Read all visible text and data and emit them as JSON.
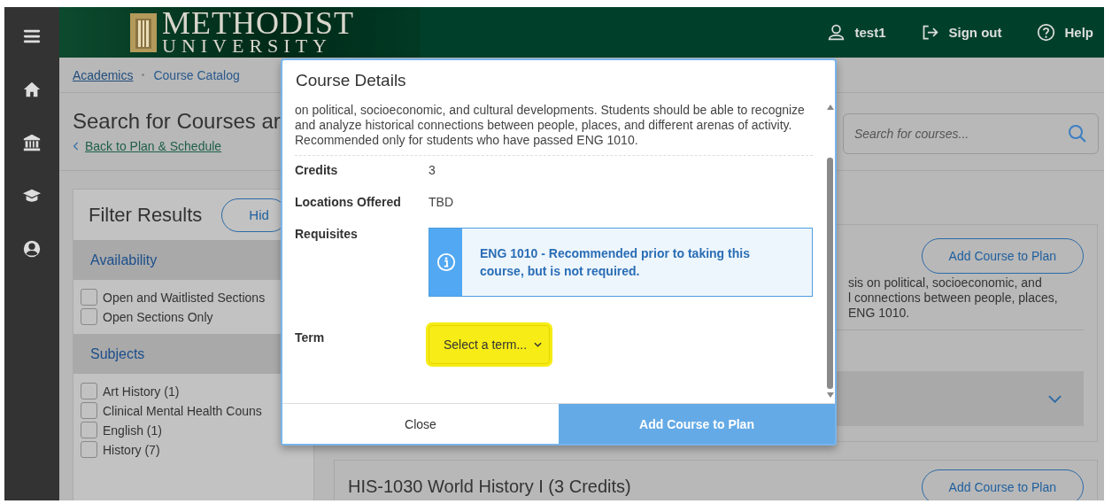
{
  "header": {
    "logo_line_1": "METHODIST",
    "logo_line_2": "UNIVERSITY",
    "user": "test1",
    "sign_out": "Sign out",
    "help": "Help"
  },
  "breadcrumbs": [
    {
      "label": "Academics",
      "link": true
    },
    {
      "label": "Course Catalog",
      "link": false
    }
  ],
  "page_title": "Search for Courses ar",
  "back_link": "Back to Plan & Schedule",
  "search": {
    "placeholder": "Search for courses..."
  },
  "filter": {
    "title": "Filter Results",
    "hide_button": "Hid",
    "sections": [
      {
        "title": "Availability",
        "options": [
          {
            "label": "Open and Waitlisted Sections",
            "checked": false
          },
          {
            "label": "Open Sections Only",
            "checked": false
          }
        ]
      },
      {
        "title": "Subjects",
        "options": [
          {
            "label": "Art History (1)",
            "checked": false
          },
          {
            "label": "Clinical Mental Health Couns",
            "checked": false
          },
          {
            "label": "English (1)",
            "checked": false
          },
          {
            "label": "History (7)",
            "checked": false
          }
        ]
      }
    ]
  },
  "course_card": {
    "button": "Add Course to Plan",
    "description_lines": [
      "sis on political, socioeconomic, and",
      "l connections between people, places,",
      "ENG 1010."
    ],
    "section_expanded": false
  },
  "next_course": {
    "title": "HIS-1030 World History I (3 Credits)",
    "button": "Add Course to Plan"
  },
  "modal": {
    "title": "Course Details",
    "description": "on political, socioeconomic, and cultural developments. Students should be able to recognize and analyze historical connections between people, places, and different arenas of activity. Recommended only for students who have passed ENG 1010.",
    "details": [
      {
        "label": "Credits",
        "value": "3"
      },
      {
        "label": "Locations Offered",
        "value": "TBD"
      }
    ],
    "requisites": {
      "label": "Requisites",
      "message": "ENG 1010 - Recommended prior to taking this course, but is not required."
    },
    "term": {
      "label": "Term",
      "placeholder": "Select a term...",
      "highlighted": true
    },
    "buttons": [
      {
        "label": "Close",
        "primary": false
      },
      {
        "label": "Add Course to Plan",
        "primary": true
      }
    ]
  }
}
